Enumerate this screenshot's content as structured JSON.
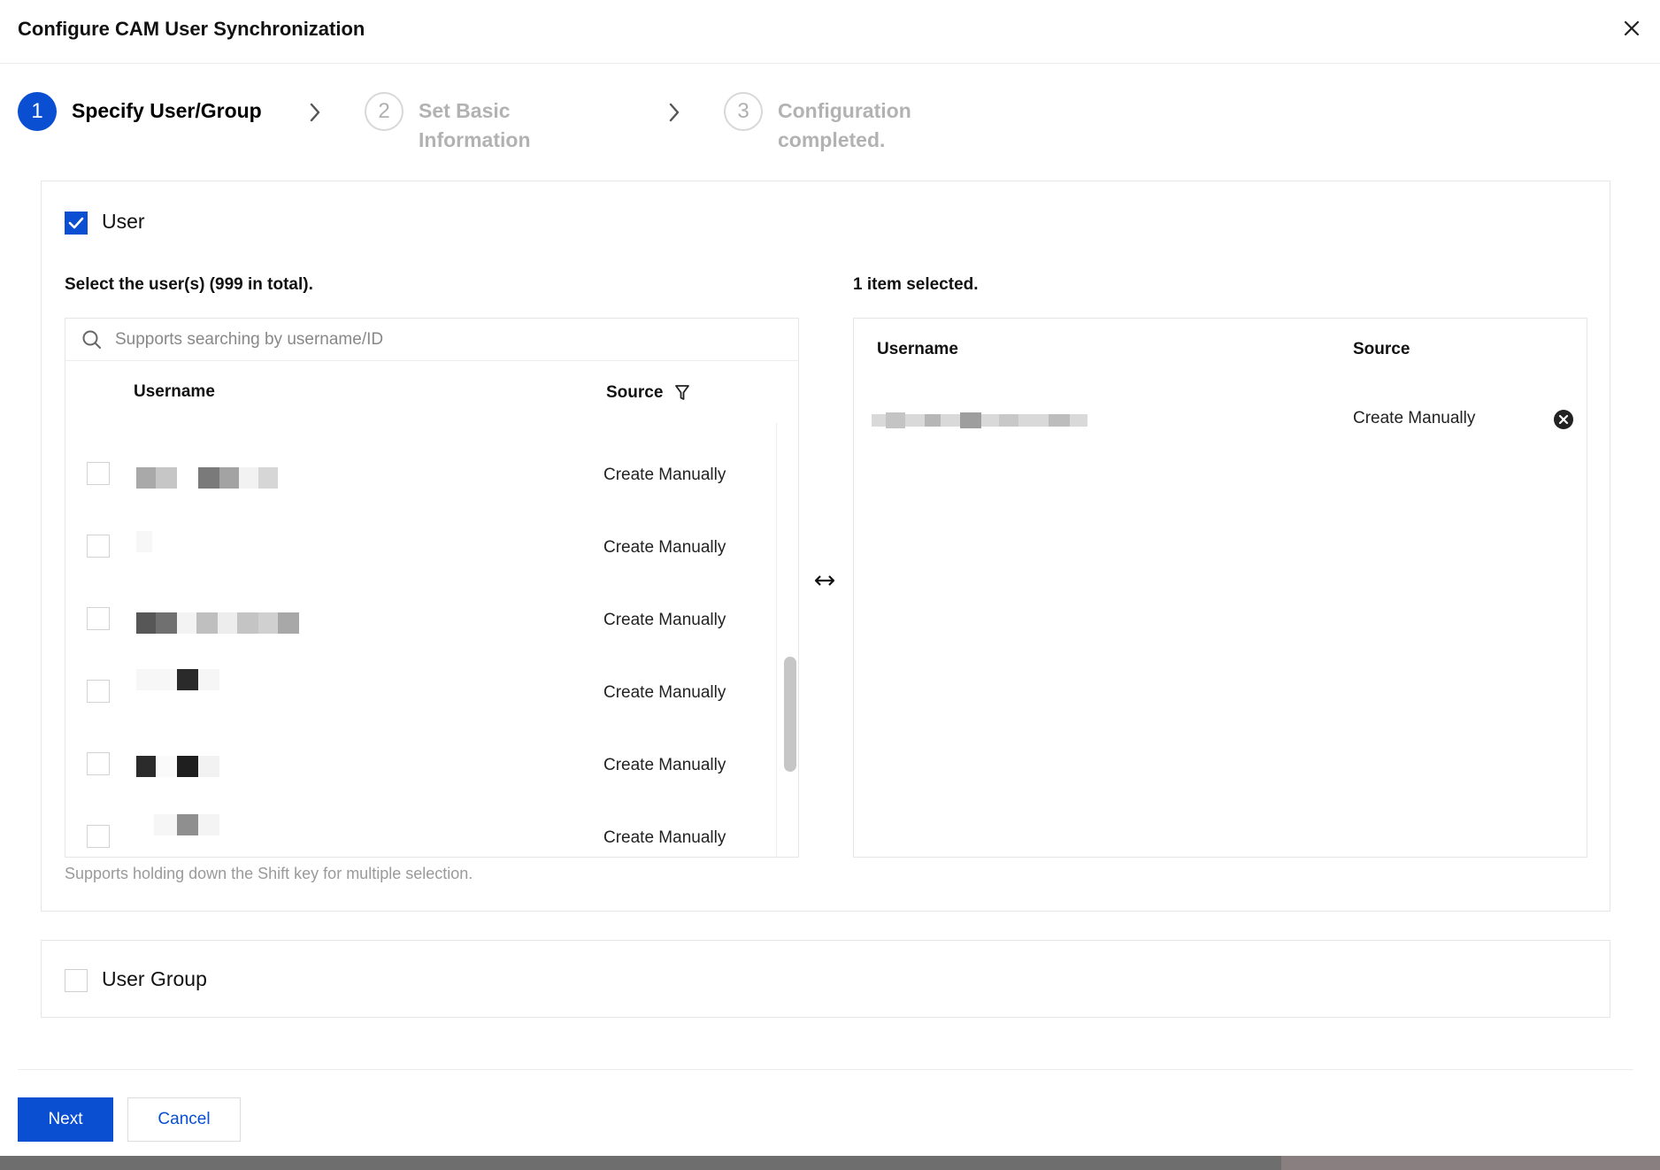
{
  "dialog": {
    "title": "Configure CAM User Synchronization"
  },
  "steps": [
    {
      "number": "1",
      "label": "Specify User/Group",
      "state": "active"
    },
    {
      "number": "2",
      "label_line1": "Set Basic",
      "label_line2": "Information",
      "state": "inactive"
    },
    {
      "number": "3",
      "label_line1": "Configuration",
      "label_line2": "completed.",
      "state": "inactive"
    }
  ],
  "user_section": {
    "checkbox_label": "User",
    "checked": true,
    "left_title": "Select the user(s) (999 in total).",
    "search_placeholder": "Supports searching by username/ID",
    "columns": {
      "username": "Username",
      "source": "Source"
    },
    "rows": [
      {
        "username": "",
        "source": "Create Manually",
        "checked": false
      },
      {
        "username": "",
        "source": "Create Manually",
        "checked": false
      },
      {
        "username": "",
        "source": "Create Manually",
        "checked": false
      },
      {
        "username": "",
        "source": "Create Manually",
        "checked": false
      },
      {
        "username": "",
        "source": "Create Manually",
        "checked": false
      },
      {
        "username": "",
        "source": "Create Manually",
        "checked": false
      }
    ],
    "right_title": "1 item selected.",
    "selected_columns": {
      "username": "Username",
      "source": "Source"
    },
    "selected_rows": [
      {
        "username": "",
        "source": "Create Manually"
      }
    ],
    "hint": "Supports holding down the Shift key for multiple selection."
  },
  "group_section": {
    "checkbox_label": "User Group",
    "checked": false
  },
  "footer": {
    "next_label": "Next",
    "cancel_label": "Cancel"
  },
  "colors": {
    "primary": "#0a4fd2",
    "step_inactive": "#b2b2b2",
    "border": "#e6e6e6"
  },
  "icons": [
    "close-icon",
    "chevron-right-icon",
    "check-icon",
    "search-icon",
    "filter-icon",
    "swap-icon",
    "remove-circle-icon"
  ]
}
